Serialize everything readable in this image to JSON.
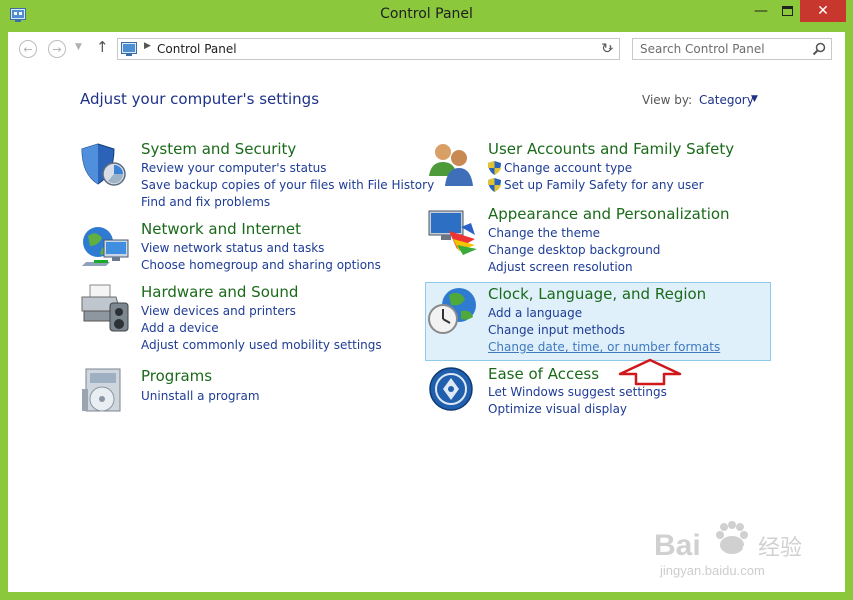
{
  "window": {
    "title": "Control Panel",
    "minimize_icon": "minimize-icon",
    "maximize_icon": "maximize-icon",
    "close_icon": "close-icon"
  },
  "navigation": {
    "breadcrumb": "Control Panel",
    "search_placeholder": "Search Control Panel"
  },
  "header": {
    "heading": "Adjust your computer's settings",
    "view_by_label": "View by:",
    "view_by_value": "Category"
  },
  "categories": [
    {
      "title": "System and Security",
      "icon": "shield-icon",
      "links": [
        "Review your computer's status",
        "Save backup copies of your files with File History",
        "Find and fix problems"
      ]
    },
    {
      "title": "Network and Internet",
      "icon": "network-globe-icon",
      "links": [
        "View network status and tasks",
        "Choose homegroup and sharing options"
      ]
    },
    {
      "title": "Hardware and Sound",
      "icon": "printer-speaker-icon",
      "links": [
        "View devices and printers",
        "Add a device",
        "Adjust commonly used mobility settings"
      ]
    },
    {
      "title": "Programs",
      "icon": "programs-disc-icon",
      "links": [
        "Uninstall a program"
      ]
    },
    {
      "title": "User Accounts and Family Safety",
      "icon": "users-icon",
      "links": [
        "Change account type",
        "Set up Family Safety for any user"
      ]
    },
    {
      "title": "Appearance and Personalization",
      "icon": "monitor-palette-icon",
      "links": [
        "Change the theme",
        "Change desktop background",
        "Adjust screen resolution"
      ]
    },
    {
      "title": "Clock, Language, and Region",
      "icon": "clock-globe-icon",
      "links": [
        "Add a language",
        "Change input methods",
        "Change date, time, or number formats"
      ]
    },
    {
      "title": "Ease of Access",
      "icon": "ease-of-access-icon",
      "links": [
        "Let Windows suggest settings",
        "Optimize visual display"
      ]
    }
  ],
  "colors": {
    "window_frame": "#8cc83c",
    "link": "#1e3c96",
    "category_title": "#1a6a1a",
    "highlight_bg": "#dff0fa",
    "annotation_arrow": "#d0171b"
  },
  "watermark": {
    "brand": "Bai",
    "brand2": "du",
    "chinese": "经验",
    "url": "jingyan.baidu.com"
  }
}
